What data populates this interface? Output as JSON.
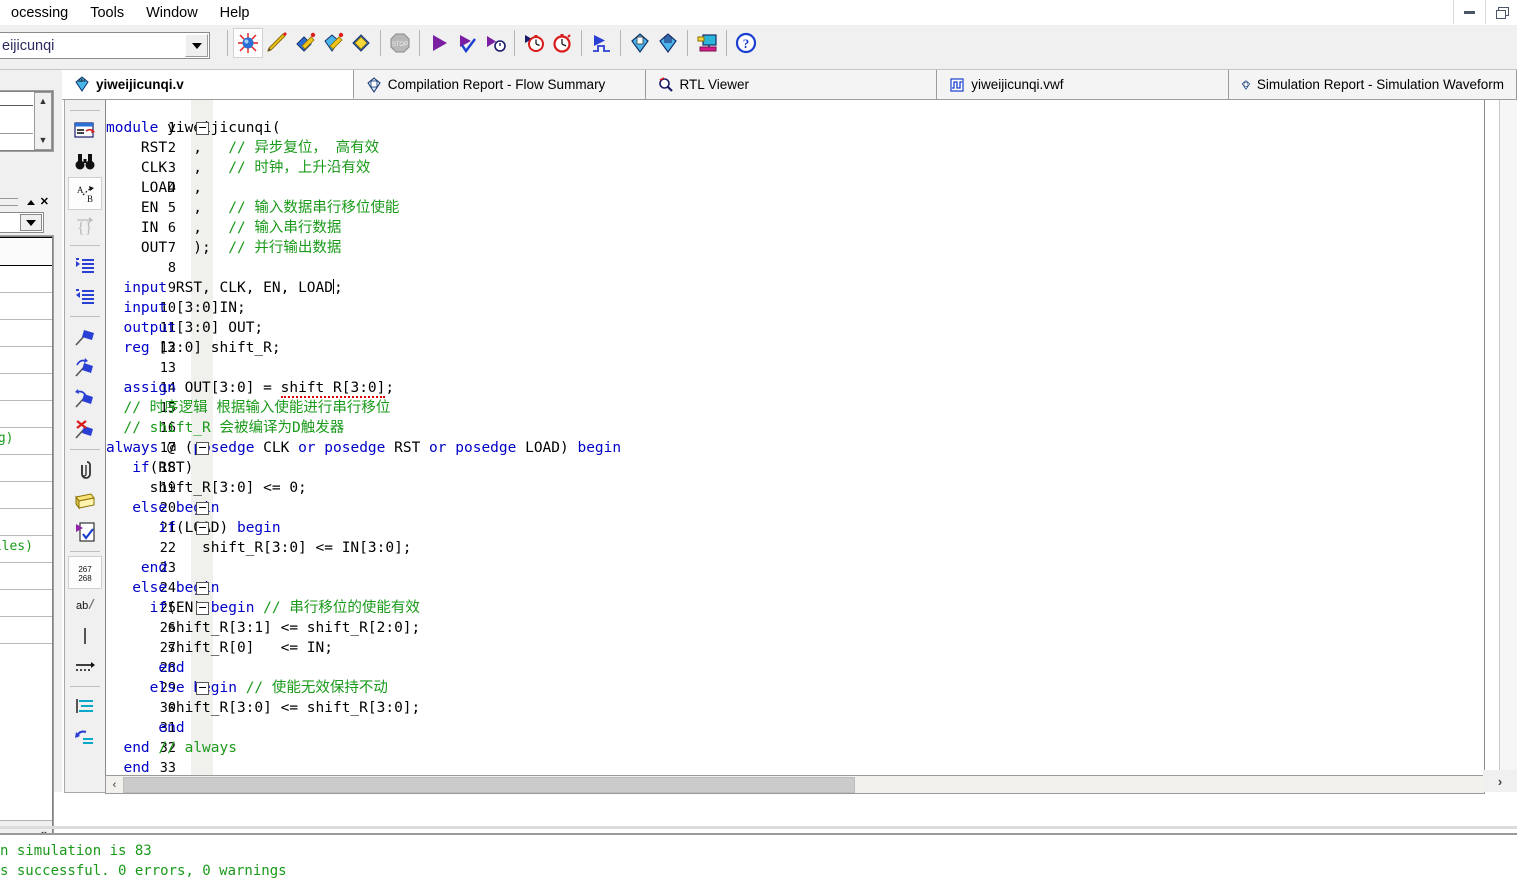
{
  "window": {
    "minimize_label": "minimize",
    "restore_label": "restore"
  },
  "menubar": {
    "items": [
      {
        "label": "ocessing",
        "name": "menu-processing"
      },
      {
        "label": "Tools",
        "name": "menu-tools"
      },
      {
        "label": "Window",
        "name": "menu-window"
      },
      {
        "label": "Help",
        "name": "menu-help"
      }
    ]
  },
  "toolbar": {
    "project_combo_value": "eijicunqi",
    "buttons": [
      {
        "name": "start-compilation-icon",
        "title": "Start Compilation"
      },
      {
        "name": "analyze-synthesis-icon",
        "title": "Analysis & Synthesis"
      },
      {
        "name": "fitter-icon",
        "title": "Fitter"
      },
      {
        "name": "assembler-icon",
        "title": "Assembler"
      },
      {
        "name": "timing-analyzer-icon",
        "title": "TimeQuest Timing Analyzer"
      },
      {
        "name": "stop-processing-icon",
        "title": "Stop Processing"
      },
      {
        "name": "start-analysis-icon",
        "title": "Start Analysis & Elaboration"
      },
      {
        "name": "start-compilation-check-icon",
        "title": "Start Compilation Check"
      },
      {
        "name": "start-timing-icon",
        "title": "Start Timing Analysis"
      },
      {
        "name": "timing-red-1-icon",
        "title": "TimeQuest Timing Analyzer Tool"
      },
      {
        "name": "timing-red-2-icon",
        "title": "Classic Timing Analyzer Tool"
      },
      {
        "name": "start-simulation-icon",
        "title": "Start Simulation"
      },
      {
        "name": "programmer-icon",
        "title": "Programmer"
      },
      {
        "name": "assignment-editor-icon",
        "title": "Assignment Editor"
      },
      {
        "name": "pin-planner-icon",
        "title": "Pin Planner"
      },
      {
        "name": "help-icon",
        "title": "Help"
      }
    ]
  },
  "tabs": [
    {
      "label": "yiweijicunqi.v",
      "icon": "verilog-file-icon",
      "active": true
    },
    {
      "label": "Compilation Report - Flow Summary",
      "icon": "report-icon",
      "active": false
    },
    {
      "label": "RTL Viewer",
      "icon": "rtl-viewer-icon",
      "active": false
    },
    {
      "label": "yiweijicunqi.vwf",
      "icon": "waveform-file-icon",
      "active": false
    },
    {
      "label": "Simulation Report - Simulation Waveform",
      "icon": "report-icon",
      "active": false
    }
  ],
  "left_panels": {
    "entity_row_label": "ng)",
    "files_row_label": "files)",
    "expand_label": "»"
  },
  "editor_vertical_toolbar": [
    {
      "name": "find-replace-icon"
    },
    {
      "name": "find-binoculars-icon"
    },
    {
      "name": "go-to-icon"
    },
    {
      "name": "match-brace-icon"
    },
    {
      "name": "increase-indent-icon"
    },
    {
      "name": "decrease-indent-icon"
    },
    {
      "name": "insert-bookmark-icon"
    },
    {
      "name": "next-bookmark-icon"
    },
    {
      "name": "previous-bookmark-icon"
    },
    {
      "name": "clear-bookmarks-icon"
    },
    {
      "name": "insert-template-icon"
    },
    {
      "name": "insert-file-icon"
    },
    {
      "name": "insert-constraint-icon"
    },
    {
      "name": "line-numbers-icon",
      "label_top": "267",
      "label_bottom": "268"
    },
    {
      "name": "toggle-comment-icon",
      "label": "ab/"
    },
    {
      "name": "text-cursor-icon"
    },
    {
      "name": "tab-arrow-icon"
    },
    {
      "name": "align-icon"
    },
    {
      "name": "undo-align-icon"
    }
  ],
  "code": {
    "line_count": 33,
    "fold_lines": [
      1,
      17,
      20,
      21,
      24,
      25,
      29
    ],
    "lines": [
      {
        "n": 1,
        "tokens": [
          {
            "t": "module",
            "c": "kw"
          },
          {
            "t": " yiweijicunqi(",
            "c": "pl"
          }
        ]
      },
      {
        "n": 2,
        "tokens": [
          {
            "t": "    RST   ,   ",
            "c": "pl"
          },
          {
            "t": "// 异步复位， 高有效",
            "c": "cm"
          }
        ]
      },
      {
        "n": 3,
        "tokens": [
          {
            "t": "    CLK   ,   ",
            "c": "pl"
          },
          {
            "t": "// 时钟，上升沿有效",
            "c": "cm"
          }
        ]
      },
      {
        "n": 4,
        "tokens": [
          {
            "t": "    LOAD  ,",
            "c": "pl"
          }
        ]
      },
      {
        "n": 5,
        "tokens": [
          {
            "t": "    EN    ,   ",
            "c": "pl"
          },
          {
            "t": "// 输入数据串行移位使能",
            "c": "cm"
          }
        ]
      },
      {
        "n": 6,
        "tokens": [
          {
            "t": "    IN    ,   ",
            "c": "pl"
          },
          {
            "t": "// 输入串行数据",
            "c": "cm"
          }
        ]
      },
      {
        "n": 7,
        "tokens": [
          {
            "t": "    OUT   );  ",
            "c": "pl"
          },
          {
            "t": "// 并行输出数据",
            "c": "cm"
          }
        ]
      },
      {
        "n": 8,
        "tokens": []
      },
      {
        "n": 9,
        "tokens": [
          {
            "t": "  ",
            "c": "pl"
          },
          {
            "t": "input",
            "c": "kw"
          },
          {
            "t": " RST, CLK, EN, LOAD",
            "c": "pl"
          },
          {
            "t": "|",
            "c": "caret"
          },
          {
            "t": ";",
            "c": "pl"
          }
        ]
      },
      {
        "n": 10,
        "tokens": [
          {
            "t": "  ",
            "c": "pl"
          },
          {
            "t": "input",
            "c": "kw"
          },
          {
            "t": " [3:0]IN;",
            "c": "pl"
          }
        ]
      },
      {
        "n": 11,
        "tokens": [
          {
            "t": "  ",
            "c": "pl"
          },
          {
            "t": "output",
            "c": "kw"
          },
          {
            "t": "[3:0] OUT;",
            "c": "pl"
          }
        ]
      },
      {
        "n": 12,
        "tokens": [
          {
            "t": "  ",
            "c": "pl"
          },
          {
            "t": "reg",
            "c": "kw"
          },
          {
            "t": " [3:0] shift_R;",
            "c": "pl"
          }
        ]
      },
      {
        "n": 13,
        "tokens": []
      },
      {
        "n": 14,
        "tokens": [
          {
            "t": "  ",
            "c": "pl"
          },
          {
            "t": "assign",
            "c": "kw"
          },
          {
            "t": " OUT[3:0] = ",
            "c": "pl"
          },
          {
            "t": "shift R[3:0]",
            "c": "sq"
          },
          {
            "t": ";",
            "c": "pl"
          }
        ]
      },
      {
        "n": 15,
        "tokens": [
          {
            "t": "  ",
            "c": "pl"
          },
          {
            "t": "// 时序逻辑 根据输入使能进行串行移位",
            "c": "cm"
          }
        ]
      },
      {
        "n": 16,
        "tokens": [
          {
            "t": "  ",
            "c": "pl"
          },
          {
            "t": "// shift_R 会被编译为D触发器",
            "c": "cm"
          }
        ]
      },
      {
        "n": 17,
        "tokens": [
          {
            "t": "always",
            "c": "kw"
          },
          {
            "t": " @ (",
            "c": "pl"
          },
          {
            "t": "posedge",
            "c": "kw"
          },
          {
            "t": " CLK ",
            "c": "pl"
          },
          {
            "t": "or",
            "c": "kw"
          },
          {
            "t": " ",
            "c": "pl"
          },
          {
            "t": "posedge",
            "c": "kw"
          },
          {
            "t": " RST ",
            "c": "pl"
          },
          {
            "t": "or",
            "c": "kw"
          },
          {
            "t": " ",
            "c": "pl"
          },
          {
            "t": "posedge",
            "c": "kw"
          },
          {
            "t": " LOAD) ",
            "c": "pl"
          },
          {
            "t": "begin",
            "c": "kw"
          }
        ]
      },
      {
        "n": 18,
        "tokens": [
          {
            "t": "   ",
            "c": "pl"
          },
          {
            "t": "if",
            "c": "kw"
          },
          {
            "t": "(RST)",
            "c": "pl"
          }
        ]
      },
      {
        "n": 19,
        "tokens": [
          {
            "t": "     shift_R[3:0] <= 0;",
            "c": "pl"
          }
        ]
      },
      {
        "n": 20,
        "tokens": [
          {
            "t": "   ",
            "c": "pl"
          },
          {
            "t": "else begin",
            "c": "kw"
          }
        ]
      },
      {
        "n": 21,
        "tokens": [
          {
            "t": "      ",
            "c": "pl"
          },
          {
            "t": "if",
            "c": "kw"
          },
          {
            "t": "(LOAD) ",
            "c": "pl"
          },
          {
            "t": "begin",
            "c": "kw"
          }
        ]
      },
      {
        "n": 22,
        "tokens": [
          {
            "t": "           shift_R[3:0] <= IN[3:0];",
            "c": "pl"
          }
        ]
      },
      {
        "n": 23,
        "tokens": [
          {
            "t": "    ",
            "c": "pl"
          },
          {
            "t": "end",
            "c": "kw"
          }
        ]
      },
      {
        "n": 24,
        "tokens": [
          {
            "t": "   ",
            "c": "pl"
          },
          {
            "t": "else begin",
            "c": "kw"
          }
        ]
      },
      {
        "n": 25,
        "tokens": [
          {
            "t": "     ",
            "c": "pl"
          },
          {
            "t": "if",
            "c": "kw"
          },
          {
            "t": "(EN) ",
            "c": "pl"
          },
          {
            "t": "begin",
            "c": "kw"
          },
          {
            "t": " ",
            "c": "pl"
          },
          {
            "t": "// 串行移位的使能有效",
            "c": "cm"
          }
        ]
      },
      {
        "n": 26,
        "tokens": [
          {
            "t": "       shift_R[3:1] <= shift_R[2:0];",
            "c": "pl"
          }
        ]
      },
      {
        "n": 27,
        "tokens": [
          {
            "t": "       shift_R[0]   <= IN;",
            "c": "pl"
          }
        ]
      },
      {
        "n": 28,
        "tokens": [
          {
            "t": "      ",
            "c": "pl"
          },
          {
            "t": "end",
            "c": "kw"
          }
        ]
      },
      {
        "n": 29,
        "tokens": [
          {
            "t": "     ",
            "c": "pl"
          },
          {
            "t": "else begin",
            "c": "kw"
          },
          {
            "t": " ",
            "c": "pl"
          },
          {
            "t": "// 使能无效保持不动",
            "c": "cm"
          }
        ]
      },
      {
        "n": 30,
        "tokens": [
          {
            "t": "       shift_R[3:0] <= shift_R[3:0];",
            "c": "pl"
          }
        ]
      },
      {
        "n": 31,
        "tokens": [
          {
            "t": "      ",
            "c": "pl"
          },
          {
            "t": "end",
            "c": "kw"
          }
        ]
      },
      {
        "n": 32,
        "tokens": [
          {
            "t": "  ",
            "c": "pl"
          },
          {
            "t": "end",
            "c": "kw"
          },
          {
            "t": " ",
            "c": "pl"
          },
          {
            "t": "// always",
            "c": "cm"
          }
        ]
      },
      {
        "n": 33,
        "tokens": [
          {
            "t": "  ",
            "c": "pl"
          },
          {
            "t": "end",
            "c": "kw"
          }
        ]
      }
    ]
  },
  "messages": {
    "lines": [
      "n simulation is 83",
      "s successful. 0 errors, 0 warnings"
    ],
    "color": "#1a9a1a"
  },
  "scrollbars": {
    "h_left_arrow": "‹",
    "right_arrow": "›"
  },
  "colors": {
    "keyword": "#0000c8",
    "comment": "#1a9a1a",
    "plain": "#000000",
    "toolbar_bg": "#f0f0f0",
    "editor_bg": "#ffffff"
  }
}
